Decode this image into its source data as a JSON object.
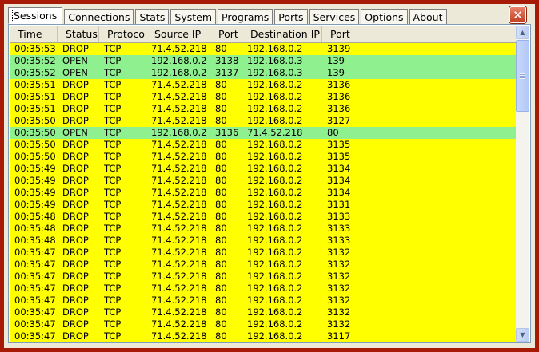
{
  "tabs": [
    {
      "label": "Sessions",
      "active": true
    },
    {
      "label": "Connections",
      "active": false
    },
    {
      "label": "Stats",
      "active": false
    },
    {
      "label": "System",
      "active": false
    },
    {
      "label": "Programs",
      "active": false
    },
    {
      "label": "Ports",
      "active": false
    },
    {
      "label": "Services",
      "active": false
    },
    {
      "label": "Options",
      "active": false
    },
    {
      "label": "About",
      "active": false
    }
  ],
  "close_label": "✕",
  "colors": {
    "drop": "#ffff00",
    "open": "#8ef08e",
    "frame": "#a61a06"
  },
  "table": {
    "columns": [
      "Time",
      "Status",
      "Protocol",
      "Source IP",
      "Port",
      "Destination IP",
      "Port"
    ],
    "rows": [
      [
        "00:35:53",
        "DROP",
        "TCP",
        "71.4.52.218",
        "80",
        "192.168.0.2",
        "3139"
      ],
      [
        "00:35:52",
        "OPEN",
        "TCP",
        "192.168.0.2",
        "3138",
        "192.168.0.3",
        "139"
      ],
      [
        "00:35:52",
        "OPEN",
        "TCP",
        "192.168.0.2",
        "3137",
        "192.168.0.3",
        "139"
      ],
      [
        "00:35:51",
        "DROP",
        "TCP",
        "71.4.52.218",
        "80",
        "192.168.0.2",
        "3136"
      ],
      [
        "00:35:51",
        "DROP",
        "TCP",
        "71.4.52.218",
        "80",
        "192.168.0.2",
        "3136"
      ],
      [
        "00:35:51",
        "DROP",
        "TCP",
        "71.4.52.218",
        "80",
        "192.168.0.2",
        "3136"
      ],
      [
        "00:35:50",
        "DROP",
        "TCP",
        "71.4.52.218",
        "80",
        "192.168.0.2",
        "3127"
      ],
      [
        "00:35:50",
        "OPEN",
        "TCP",
        "192.168.0.2",
        "3136",
        "71.4.52.218",
        "80"
      ],
      [
        "00:35:50",
        "DROP",
        "TCP",
        "71.4.52.218",
        "80",
        "192.168.0.2",
        "3135"
      ],
      [
        "00:35:50",
        "DROP",
        "TCP",
        "71.4.52.218",
        "80",
        "192.168.0.2",
        "3135"
      ],
      [
        "00:35:49",
        "DROP",
        "TCP",
        "71.4.52.218",
        "80",
        "192.168.0.2",
        "3134"
      ],
      [
        "00:35:49",
        "DROP",
        "TCP",
        "71.4.52.218",
        "80",
        "192.168.0.2",
        "3134"
      ],
      [
        "00:35:49",
        "DROP",
        "TCP",
        "71.4.52.218",
        "80",
        "192.168.0.2",
        "3134"
      ],
      [
        "00:35:49",
        "DROP",
        "TCP",
        "71.4.52.218",
        "80",
        "192.168.0.2",
        "3131"
      ],
      [
        "00:35:48",
        "DROP",
        "TCP",
        "71.4.52.218",
        "80",
        "192.168.0.2",
        "3133"
      ],
      [
        "00:35:48",
        "DROP",
        "TCP",
        "71.4.52.218",
        "80",
        "192.168.0.2",
        "3133"
      ],
      [
        "00:35:48",
        "DROP",
        "TCP",
        "71.4.52.218",
        "80",
        "192.168.0.2",
        "3133"
      ],
      [
        "00:35:47",
        "DROP",
        "TCP",
        "71.4.52.218",
        "80",
        "192.168.0.2",
        "3132"
      ],
      [
        "00:35:47",
        "DROP",
        "TCP",
        "71.4.52.218",
        "80",
        "192.168.0.2",
        "3132"
      ],
      [
        "00:35:47",
        "DROP",
        "TCP",
        "71.4.52.218",
        "80",
        "192.168.0.2",
        "3132"
      ],
      [
        "00:35:47",
        "DROP",
        "TCP",
        "71.4.52.218",
        "80",
        "192.168.0.2",
        "3132"
      ],
      [
        "00:35:47",
        "DROP",
        "TCP",
        "71.4.52.218",
        "80",
        "192.168.0.2",
        "3132"
      ],
      [
        "00:35:47",
        "DROP",
        "TCP",
        "71.4.52.218",
        "80",
        "192.168.0.2",
        "3132"
      ],
      [
        "00:35:47",
        "DROP",
        "TCP",
        "71.4.52.218",
        "80",
        "192.168.0.2",
        "3132"
      ],
      [
        "00:35:47",
        "DROP",
        "TCP",
        "71.4.52.218",
        "80",
        "192.168.0.2",
        "3117"
      ]
    ]
  },
  "scrollbar": {
    "up_icon": "▲",
    "down_icon": "▼",
    "position": 0.0
  }
}
